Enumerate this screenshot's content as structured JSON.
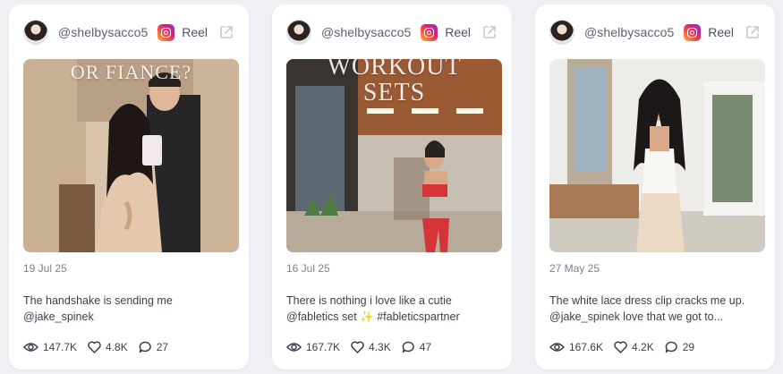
{
  "cards": [
    {
      "handle": "@shelbysacco5",
      "post_type": "Reel",
      "overlay_text": "OR FIANCE?",
      "date": "19 Jul 25",
      "caption_line1": "The handshake is sending me",
      "caption_line2": "@jake_spinek",
      "views": "147.7K",
      "likes": "4.8K",
      "comments": "27"
    },
    {
      "handle": "@shelbysacco5",
      "post_type": "Reel",
      "overlay_text_line1": "WORKOUT",
      "overlay_text_line2": "SETS",
      "date": "16 Jul 25",
      "caption_line1": "There is nothing i love like a cutie",
      "caption_line2": "@fabletics set ✨ #fableticspartner",
      "views": "167.7K",
      "likes": "4.3K",
      "comments": "47"
    },
    {
      "handle": "@shelbysacco5",
      "post_type": "Reel",
      "date": "27 May 25",
      "caption_line1": "The white lace dress clip cracks me up.",
      "caption_line2": "@jake_spinek love that we got to...",
      "views": "167.6K",
      "likes": "4.2K",
      "comments": "29"
    }
  ],
  "icons": {
    "platform": "instagram-icon",
    "external": "external-link-icon",
    "views": "eye-icon",
    "likes": "heart-icon",
    "comments": "comment-icon"
  },
  "colors": {
    "page_bg": "#eef0f4",
    "card_bg": "#ffffff",
    "muted_text": "#7a8090",
    "icon_stroke": "#c4c8d0"
  }
}
